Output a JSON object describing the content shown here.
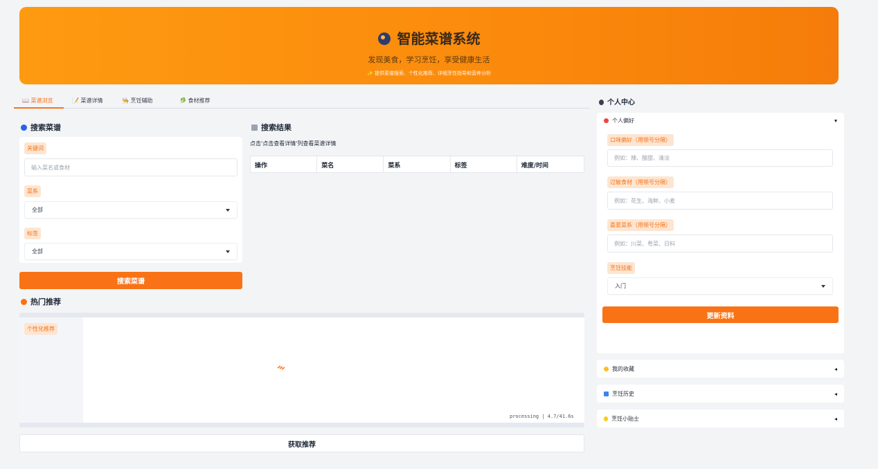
{
  "header": {
    "title": "智能菜谱系统",
    "subtitle": "发现美食，学习烹饪，享受健康生活",
    "description": "✨ 提供菜谱搜索、个性化推荐、详细烹饪指导和营养分析"
  },
  "tabs": [
    {
      "label": "📖 菜谱浏览",
      "active": true
    },
    {
      "label": "📝 菜谱详情",
      "active": false
    },
    {
      "label": "👨‍🍳 烹饪辅助",
      "active": false
    },
    {
      "label": "🥬 食材推荐",
      "active": false
    }
  ],
  "search": {
    "section_title": "搜索菜谱",
    "keyword_label": "关键词",
    "keyword_placeholder": "输入菜名或食材",
    "cuisine_label": "菜系",
    "cuisine_value": "全部",
    "tag_label": "标签",
    "tag_value": "全部",
    "button_label": "搜索菜谱"
  },
  "results": {
    "section_title": "搜索结果",
    "note": "点击'点击查看详情'列查看菜谱详情",
    "columns": [
      "操作",
      "菜名",
      "菜系",
      "标签",
      "难度/时间"
    ]
  },
  "hot": {
    "section_title": "热门推荐",
    "label": "个性化推荐",
    "status": "processing | 4.7/41.6s",
    "button_label": "获取推荐"
  },
  "profile": {
    "section_title": "个人中心",
    "preferences_title": "个人偏好",
    "taste_label": "口味偏好（用顿号分隔）",
    "taste_placeholder": "例如：辣、酸甜、清淡",
    "allergy_label": "过敏食材（用顿号分隔）",
    "allergy_placeholder": "例如：花生、海鲜、小麦",
    "cuisine_label": "喜爱菜系（用顿号分隔）",
    "cuisine_placeholder": "例如：川菜、粤菜、日料",
    "skill_label": "烹饪技能",
    "skill_value": "入门",
    "update_button": "更新资料",
    "favorites_title": "我的收藏",
    "history_title": "烹饪历史",
    "tips_title": "烹饪小贴士"
  },
  "colors": {
    "accent": "#f97316",
    "hero_start": "#fe9a11",
    "hero_end": "#f57c0a"
  }
}
